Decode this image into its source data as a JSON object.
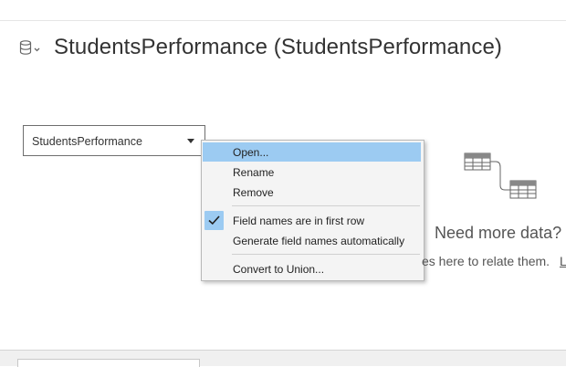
{
  "header": {
    "title": "StudentsPerformance (StudentsPerformance)"
  },
  "connection": {
    "table_name": "StudentsPerformance"
  },
  "context_menu": {
    "items": [
      {
        "label": "Open...",
        "highlighted": true
      },
      {
        "label": "Rename"
      },
      {
        "label": "Remove"
      },
      {
        "label": "Field names are in first row",
        "checked": true
      },
      {
        "label": "Generate field names automatically"
      },
      {
        "label": "Convert to Union..."
      }
    ]
  },
  "canvas": {
    "need_more_data": "Need more data?",
    "drag_hint": "es here to relate them.",
    "learn_link": "L"
  },
  "colors": {
    "menu_highlight": "#9ccbf2",
    "menu_background": "#f4f4f4",
    "icon_gray": "#666666"
  },
  "icons": [
    "database-icon",
    "chevron-down-icon",
    "dropdown-caret-icon",
    "checkmark-icon",
    "relationship-tables-icon"
  ]
}
